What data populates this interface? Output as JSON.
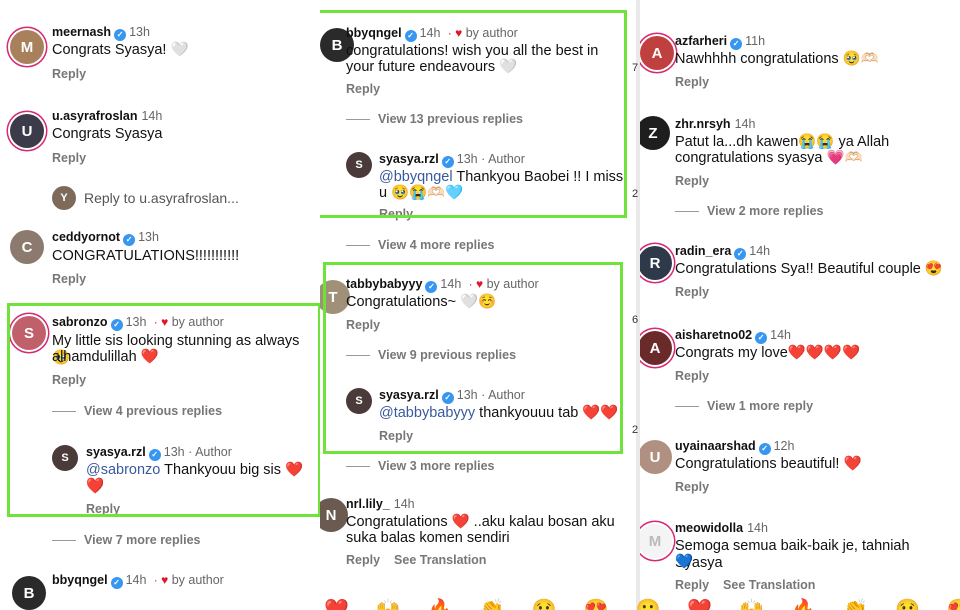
{
  "col1": {
    "c1": {
      "user": "meernash",
      "time": "13h",
      "text": "Congrats Syasya! 🤍",
      "reply": "Reply"
    },
    "c2": {
      "user": "u.asyrafroslan",
      "time": "14h",
      "text": "Congrats Syasya",
      "reply": "Reply"
    },
    "reply_to": "Reply to u.asyrafroslan...",
    "c3": {
      "user": "ceddyornot",
      "time": "13h",
      "text": "CONGRATULATIONS!!!!!!!!!!!",
      "reply": "Reply"
    },
    "c4": {
      "user": "sabronzo",
      "time": "13h",
      "by_author": "by author",
      "text1": "My little sis looking stunning as always 🥹",
      "text2": "alhamdulillah ❤️",
      "reply": "Reply"
    },
    "view_prev": "View 4 previous replies",
    "r1": {
      "user": "syasya.rzl",
      "time": "13h",
      "role": "Author",
      "mention": "@sabronzo",
      "text1": " Thankyouu big sis ❤️❤️",
      "text2": "❤️",
      "reply": "Reply"
    },
    "view_more": "View 7 more replies",
    "c5": {
      "user": "bbyqngel",
      "time": "14h",
      "by_author": "by author"
    }
  },
  "col2": {
    "c1": {
      "user": "bbyqngel",
      "time": "14h",
      "by_author": "by author",
      "text1": "congratulations! wish you all the best in",
      "text2": "your future endeavours 🤍",
      "reply": "Reply"
    },
    "view_prev": "View 13 previous replies",
    "r1": {
      "user": "syasya.rzl",
      "time": "13h",
      "role": "Author",
      "mention": "@bbyqngel",
      "text1": " Thankyou Baobei !! I miss",
      "text2": "u 🥹😭🫶🏻🩵",
      "reply": "Reply"
    },
    "view_more": "View 4 more replies",
    "c2": {
      "user": "tabbybabyyy",
      "time": "14h",
      "by_author": "by author",
      "text": "Congratulations~ 🤍☺️",
      "reply": "Reply"
    },
    "view_prev2": "View 9 previous replies",
    "r2": {
      "user": "syasya.rzl",
      "time": "13h",
      "role": "Author",
      "mention": "@tabbybabyyy",
      "text": " thankyouuu tab ❤️❤️",
      "reply": "Reply"
    },
    "view_more2": "View 3 more replies",
    "c3": {
      "user": "nrl.lily_",
      "time": "14h",
      "text1": "Congratulations ❤️ ..aku kalau bosan aku",
      "text2": "suka balas komen sendiri",
      "reply": "Reply",
      "translate": "See Translation"
    }
  },
  "col3": {
    "c1": {
      "user": "azfarheri",
      "time": "11h",
      "text": "Nawhhhh congratulations 🥹🫶🏻",
      "reply": "Reply"
    },
    "c2": {
      "user": "zhr.nrsyh",
      "time": "14h",
      "text1": "Patut la...dh kawen😭😭 ya Allah",
      "text2": "congratulations syasya 💗🫶🏻",
      "reply": "Reply"
    },
    "view_more": "View 2 more replies",
    "c3": {
      "user": "radin_era",
      "time": "14h",
      "text": "Congratulations Sya!! Beautiful couple 😍",
      "reply": "Reply"
    },
    "c4": {
      "user": "aisharetno02",
      "time": "14h",
      "text": "Congrats my love❤️❤️❤️❤️",
      "reply": "Reply"
    },
    "view_more2": "View 1 more reply",
    "c5": {
      "user": "uyainaarshad",
      "time": "12h",
      "text": "Congratulations beautiful! ❤️",
      "reply": "Reply"
    },
    "c6": {
      "user": "meowidolla",
      "time": "14h",
      "text1": "Semoga semua baik-baik je, tahniah Syasya",
      "text2": "💙",
      "reply": "Reply",
      "translate": "See Translation"
    }
  },
  "side_numbers": [
    "7",
    "2",
    "6",
    "2"
  ],
  "emoji_bar": [
    "❤️",
    "🙌",
    "🔥",
    "👏",
    "😢",
    "😍",
    "😮",
    "❤️",
    "🙌",
    "🔥",
    "👏",
    "😢",
    "😍",
    "😮"
  ],
  "colors": {
    "highlight": "#6fe33a",
    "verified": "#3797f0",
    "heart": "#e0162b",
    "mention": "#3a5a9c"
  }
}
